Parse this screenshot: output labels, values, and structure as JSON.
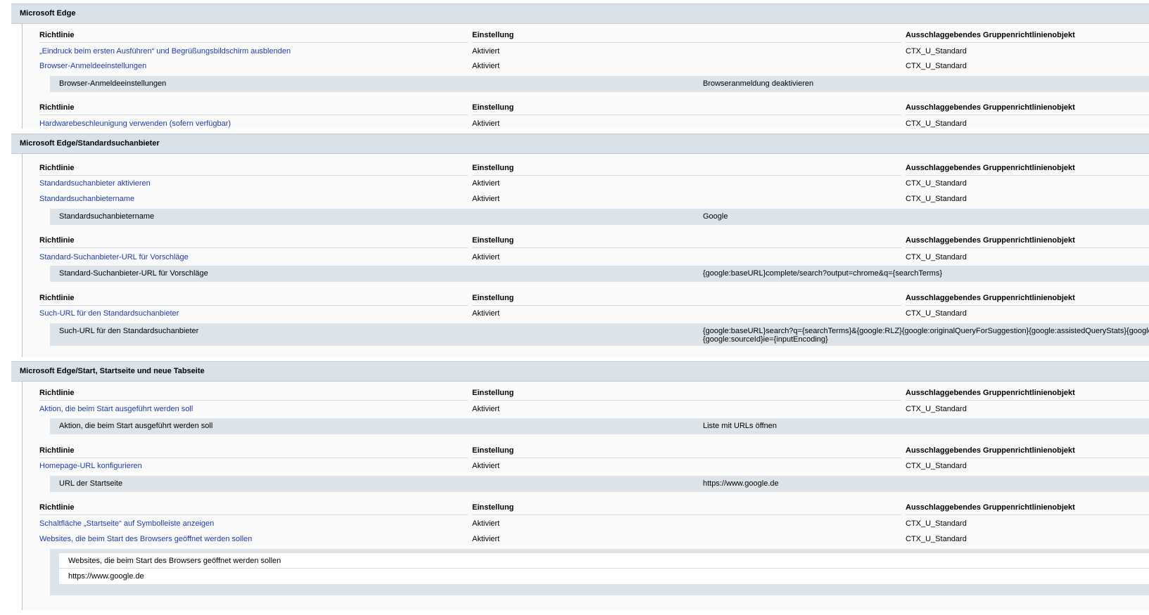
{
  "columns": {
    "policy": "Richtlinie",
    "setting": "Einstellung",
    "gpo": "Ausschlaggebendes Gruppenrichtlinienobjekt"
  },
  "sections": [
    {
      "title": "Microsoft Edge",
      "groups": [
        {
          "rows": [
            {
              "policy": "„Eindruck beim ersten Ausführen“ und Begrüßungsbildschirm ausblenden",
              "setting": "Aktiviert",
              "gpo": "CTX_U_Standard"
            },
            {
              "policy": "Browser-Anmeldeeinstellungen",
              "setting": "Aktiviert",
              "gpo": "CTX_U_Standard"
            }
          ],
          "detail": {
            "label": "Browser-Anmeldeeinstellungen",
            "value": "Browseranmeldung deaktivieren"
          }
        },
        {
          "rows": [
            {
              "policy": "Hardwarebeschleunigung verwenden (sofern verfügbar)",
              "setting": "Aktiviert",
              "gpo": "CTX_U_Standard"
            }
          ]
        }
      ]
    },
    {
      "title": "Microsoft Edge/Standardsuchanbieter",
      "groups": [
        {
          "rows": [
            {
              "policy": "Standardsuchanbieter aktivieren",
              "setting": "Aktiviert",
              "gpo": "CTX_U_Standard"
            },
            {
              "policy": "Standardsuchanbietername",
              "setting": "Aktiviert",
              "gpo": "CTX_U_Standard"
            }
          ],
          "detail": {
            "label": "Standardsuchanbietername",
            "value": "Google"
          }
        },
        {
          "rows": [
            {
              "policy": "Standard-Suchanbieter-URL für Vorschläge",
              "setting": "Aktiviert",
              "gpo": "CTX_U_Standard"
            }
          ],
          "detail": {
            "label": "Standard-Suchanbieter-URL für Vorschläge",
            "value": "{google:baseURL}complete/search?output=chrome&q={searchTerms}"
          }
        },
        {
          "rows": [
            {
              "policy": "Such-URL für den Standardsuchanbieter",
              "setting": "Aktiviert",
              "gpo": "CTX_U_Standard"
            }
          ],
          "detail": {
            "label": "Such-URL für den Standardsuchanbieter",
            "value": "{google:baseURL}search?q={searchTerms}&{google:RLZ}{google:originalQueryForSuggestion}{google:assistedQueryStats}{google",
            "value2": "{google:sourceId}ie={inputEncoding}"
          }
        }
      ]
    },
    {
      "title": "Microsoft Edge/Start, Startseite und neue Tabseite",
      "groups": [
        {
          "rows": [
            {
              "policy": "Aktion, die beim Start ausgeführt werden soll",
              "setting": "Aktiviert",
              "gpo": "CTX_U_Standard"
            }
          ],
          "detail": {
            "label": "Aktion, die beim Start ausgeführt werden soll",
            "value": "Liste mit URLs öffnen"
          }
        },
        {
          "rows": [
            {
              "policy": "Homepage-URL konfigurieren",
              "setting": "Aktiviert",
              "gpo": "CTX_U_Standard"
            }
          ],
          "detail": {
            "label": "URL der Startseite",
            "value": "https://www.google.de"
          }
        },
        {
          "rows": [
            {
              "policy": "Schaltfläche „Startseite“ auf Symbolleiste anzeigen",
              "setting": "Aktiviert",
              "gpo": "CTX_U_Standard"
            },
            {
              "policy": "Websites, die beim Start des Browsers geöffnet werden sollen",
              "setting": "Aktiviert",
              "gpo": "CTX_U_Standard"
            }
          ],
          "websites": {
            "label": "Websites, die beim Start des Browsers geöffnet werden sollen",
            "value": "https://www.google.de"
          }
        }
      ]
    }
  ]
}
